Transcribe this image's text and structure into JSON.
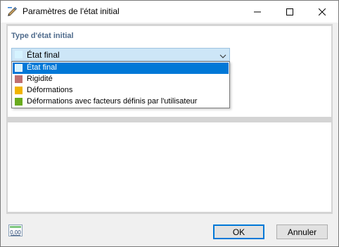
{
  "window": {
    "title": "Paramètres de l'état initial",
    "icons": {
      "app": "edit-pencil-icon",
      "minimize": "minimize-icon",
      "maximize": "maximize-icon",
      "close": "close-icon"
    }
  },
  "group": {
    "label": "Type d'état initial",
    "combo": {
      "value": "État final",
      "color": "#d5f3ff"
    },
    "options": [
      {
        "label": "État final",
        "color": "#d5f3ff",
        "selected": true
      },
      {
        "label": "Rigidité",
        "color": "#c07070",
        "selected": false
      },
      {
        "label": "Déformations",
        "color": "#f0b400",
        "selected": false
      },
      {
        "label": "Déformations avec facteurs définis par l'utilisateur",
        "color": "#6aab1e",
        "selected": false
      }
    ]
  },
  "footer": {
    "units_icon": "number-format-icon",
    "units_icon_text": "0,00",
    "ok_label": "OK",
    "cancel_label": "Annuler"
  },
  "colors": {
    "accent": "#0078d7",
    "group_label": "#4f6b8c"
  }
}
